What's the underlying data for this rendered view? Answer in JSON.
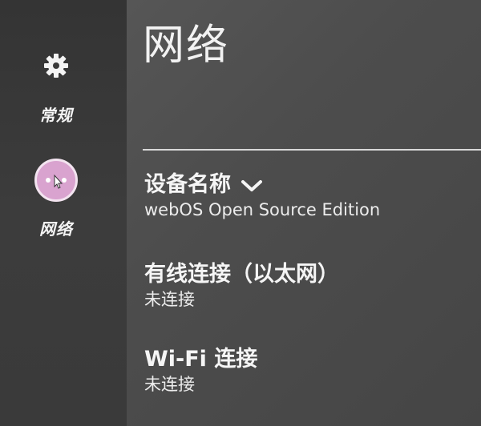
{
  "page": {
    "title": "网络"
  },
  "sidebar": {
    "items": [
      {
        "label": "常规",
        "icon": "gear-icon"
      },
      {
        "label": "网络",
        "icon": "network-icon",
        "selected": true
      }
    ]
  },
  "settings": {
    "device_name": {
      "label": "设备名称",
      "value": "webOS Open Source Edition",
      "icon": "chevron-down-icon"
    },
    "wired": {
      "label": "有线连接（以太网）",
      "value": "未连接"
    },
    "wifi": {
      "label": "Wi-Fi 连接",
      "value": "未连接"
    }
  },
  "colors": {
    "selected_circle": "#d9a3cf",
    "text": "#f5f5f5",
    "background": "#4e4e4e",
    "sidebar": "#383838"
  }
}
